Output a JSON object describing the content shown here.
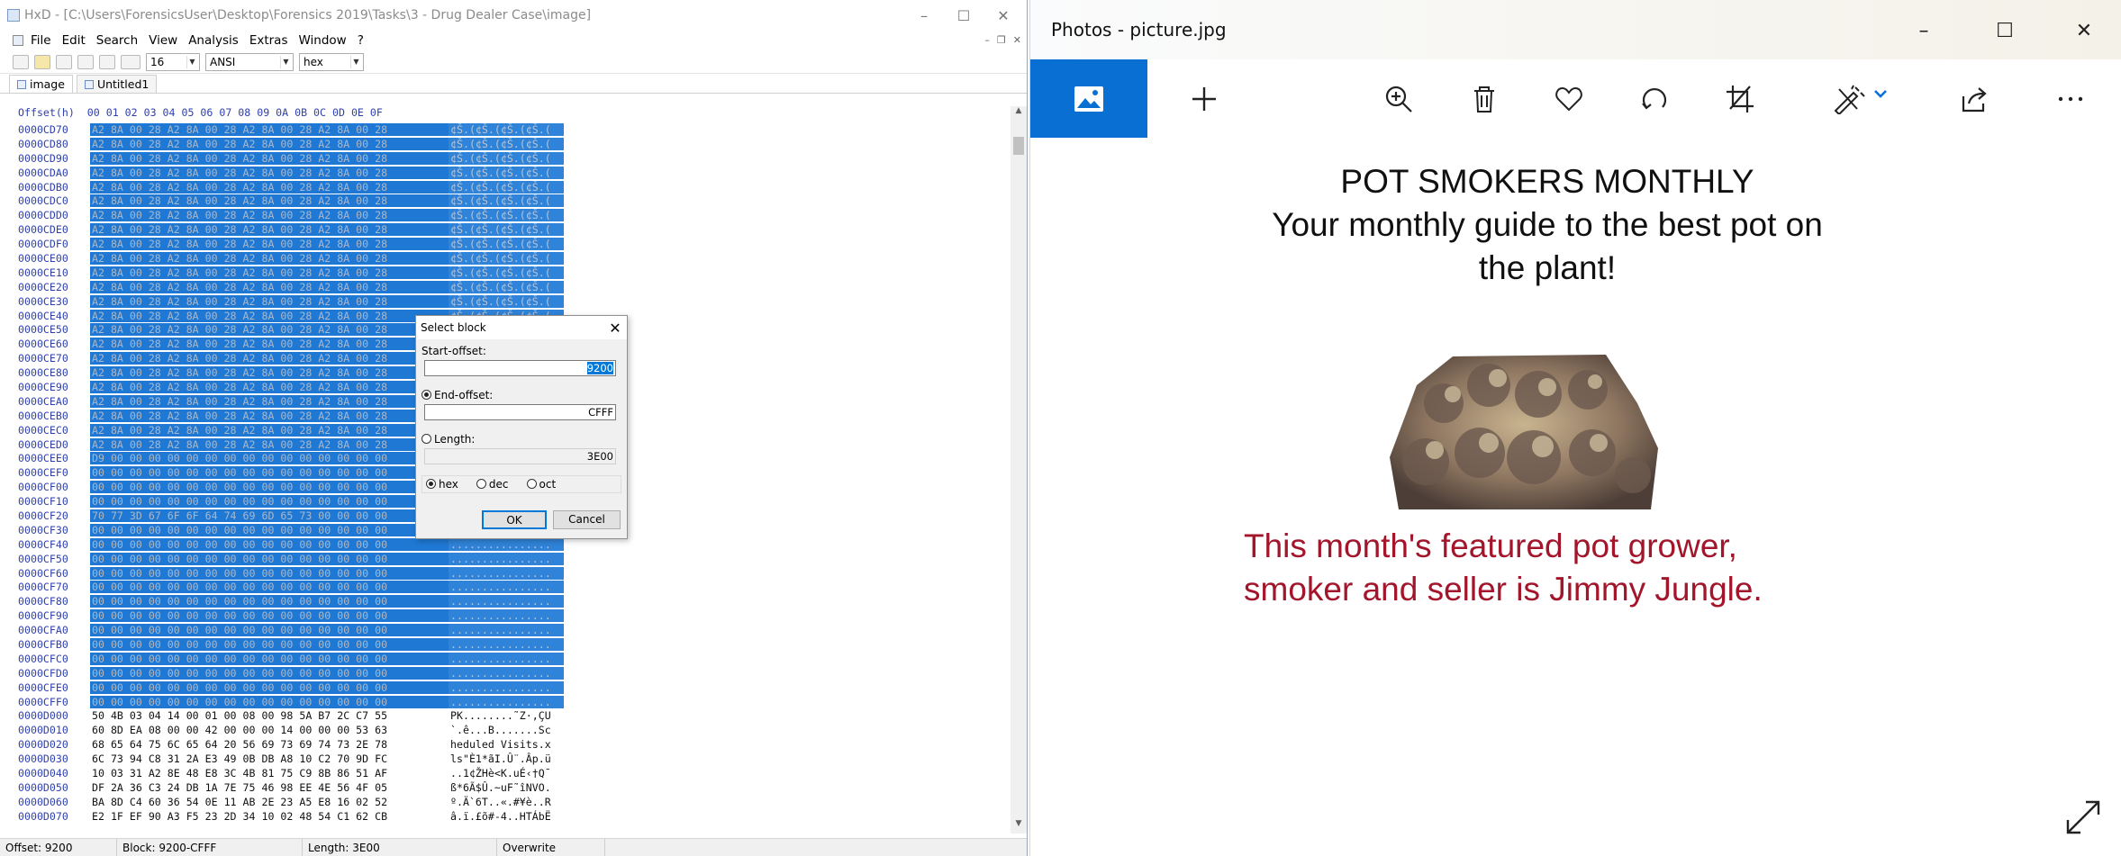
{
  "hxd": {
    "title": "HxD - [C:\\Users\\ForensicsUser\\Desktop\\Forensics 2019\\Tasks\\3 - Drug Dealer Case\\image]",
    "menu": [
      "File",
      "Edit",
      "Search",
      "View",
      "Analysis",
      "Extras",
      "Window",
      "?"
    ],
    "toolbar": {
      "bytes_per_row": "16",
      "charset": "ANSI",
      "display": "hex"
    },
    "tabs": [
      "image",
      "Untitled1"
    ],
    "header": "Offset(h)  00 01 02 03 04 05 06 07 08 09 0A 0B 0C 0D 0E 0F",
    "rows": [
      {
        "off": "0000CD70",
        "hex": "A2 8A 00 28 A2 8A 00 28 A2 8A 00 28 A2 8A 00 28",
        "asc": "¢Š.(¢Š.(¢Š.(¢Š.(",
        "sel": true
      },
      {
        "off": "0000CD80",
        "hex": "A2 8A 00 28 A2 8A 00 28 A2 8A 00 28 A2 8A 00 28",
        "asc": "¢Š.(¢Š.(¢Š.(¢Š.(",
        "sel": true
      },
      {
        "off": "0000CD90",
        "hex": "A2 8A 00 28 A2 8A 00 28 A2 8A 00 28 A2 8A 00 28",
        "asc": "¢Š.(¢Š.(¢Š.(¢Š.(",
        "sel": true
      },
      {
        "off": "0000CDA0",
        "hex": "A2 8A 00 28 A2 8A 00 28 A2 8A 00 28 A2 8A 00 28",
        "asc": "¢Š.(¢Š.(¢Š.(¢Š.(",
        "sel": true
      },
      {
        "off": "0000CDB0",
        "hex": "A2 8A 00 28 A2 8A 00 28 A2 8A 00 28 A2 8A 00 28",
        "asc": "¢Š.(¢Š.(¢Š.(¢Š.(",
        "sel": true
      },
      {
        "off": "0000CDC0",
        "hex": "A2 8A 00 28 A2 8A 00 28 A2 8A 00 28 A2 8A 00 28",
        "asc": "¢Š.(¢Š.(¢Š.(¢Š.(",
        "sel": true
      },
      {
        "off": "0000CDD0",
        "hex": "A2 8A 00 28 A2 8A 00 28 A2 8A 00 28 A2 8A 00 28",
        "asc": "¢Š.(¢Š.(¢Š.(¢Š.(",
        "sel": true
      },
      {
        "off": "0000CDE0",
        "hex": "A2 8A 00 28 A2 8A 00 28 A2 8A 00 28 A2 8A 00 28",
        "asc": "¢Š.(¢Š.(¢Š.(¢Š.(",
        "sel": true
      },
      {
        "off": "0000CDF0",
        "hex": "A2 8A 00 28 A2 8A 00 28 A2 8A 00 28 A2 8A 00 28",
        "asc": "¢Š.(¢Š.(¢Š.(¢Š.(",
        "sel": true
      },
      {
        "off": "0000CE00",
        "hex": "A2 8A 00 28 A2 8A 00 28 A2 8A 00 28 A2 8A 00 28",
        "asc": "¢Š.(¢Š.(¢Š.(¢Š.(",
        "sel": true
      },
      {
        "off": "0000CE10",
        "hex": "A2 8A 00 28 A2 8A 00 28 A2 8A 00 28 A2 8A 00 28",
        "asc": "¢Š.(¢Š.(¢Š.(¢Š.(",
        "sel": true
      },
      {
        "off": "0000CE20",
        "hex": "A2 8A 00 28 A2 8A 00 28 A2 8A 00 28 A2 8A 00 28",
        "asc": "¢Š.(¢Š.(¢Š.(¢Š.(",
        "sel": true
      },
      {
        "off": "0000CE30",
        "hex": "A2 8A 00 28 A2 8A 00 28 A2 8A 00 28 A2 8A 00 28",
        "asc": "¢Š.(¢Š.(¢Š.(¢Š.(",
        "sel": true
      },
      {
        "off": "0000CE40",
        "hex": "A2 8A 00 28 A2 8A 00 28 A2 8A 00 28 A2 8A 00 28",
        "asc": "¢Š.(¢Š.(¢Š.(¢Š.(",
        "sel": true
      },
      {
        "off": "0000CE50",
        "hex": "A2 8A 00 28 A2 8A 00 28 A2 8A 00 28 A2 8A 00 28",
        "asc": "¢Š.(¢Š.(¢Š.(¢Š.(",
        "sel": true
      },
      {
        "off": "0000CE60",
        "hex": "A2 8A 00 28 A2 8A 00 28 A2 8A 00 28 A2 8A 00 28",
        "asc": "¢Š.(¢Š.(¢Š.(¢Š.(",
        "sel": true
      },
      {
        "off": "0000CE70",
        "hex": "A2 8A 00 28 A2 8A 00 28 A2 8A 00 28 A2 8A 00 28",
        "asc": "¢Š.(¢Š.(¢Š.(¢Š.(",
        "sel": true
      },
      {
        "off": "0000CE80",
        "hex": "A2 8A 00 28 A2 8A 00 28 A2 8A 00 28 A2 8A 00 28",
        "asc": "¢Š.(¢Š.(¢Š.(¢Š.(",
        "sel": true
      },
      {
        "off": "0000CE90",
        "hex": "A2 8A 00 28 A2 8A 00 28 A2 8A 00 28 A2 8A 00 28",
        "asc": "¢Š.(¢Š.(¢Š.(¢Š.(",
        "sel": true
      },
      {
        "off": "0000CEA0",
        "hex": "A2 8A 00 28 A2 8A 00 28 A2 8A 00 28 A2 8A 00 28",
        "asc": "¢Š.(¢Š.(¢Š.(¢Š.(",
        "sel": true
      },
      {
        "off": "0000CEB0",
        "hex": "A2 8A 00 28 A2 8A 00 28 A2 8A 00 28 A2 8A 00 28",
        "asc": "¢Š.(¢Š.(¢Š.(¢Š.(",
        "sel": true
      },
      {
        "off": "0000CEC0",
        "hex": "A2 8A 00 28 A2 8A 00 28 A2 8A 00 28 A2 8A 00 28",
        "asc": "¢Š.(¢Š.(¢Š.(¢Š.(",
        "sel": true
      },
      {
        "off": "0000CED0",
        "hex": "A2 8A 00 28 A2 8A 00 28 A2 8A 00 28 A2 8A 00 28",
        "asc": "¢Š.(¢Š.(¢Š.(¢Š.(",
        "sel": true
      },
      {
        "off": "0000CEE0",
        "hex": "D9 00 00 00 00 00 00 00 00 00 00 00 00 00 00 00",
        "asc": "Ù...............",
        "sel": true
      },
      {
        "off": "0000CEF0",
        "hex": "00 00 00 00 00 00 00 00 00 00 00 00 00 00 00 00",
        "asc": "................",
        "sel": true
      },
      {
        "off": "0000CF00",
        "hex": "00 00 00 00 00 00 00 00 00 00 00 00 00 00 00 00",
        "asc": "................",
        "sel": true
      },
      {
        "off": "0000CF10",
        "hex": "00 00 00 00 00 00 00 00 00 00 00 00 00 00 00 00",
        "asc": "................",
        "sel": true
      },
      {
        "off": "0000CF20",
        "hex": "70 77 3D 67 6F 6F 64 74 69 6D 65 73 00 00 00 00",
        "asc": "pw=goodtimes....",
        "sel": true
      },
      {
        "off": "0000CF30",
        "hex": "00 00 00 00 00 00 00 00 00 00 00 00 00 00 00 00",
        "asc": "................",
        "sel": true
      },
      {
        "off": "0000CF40",
        "hex": "00 00 00 00 00 00 00 00 00 00 00 00 00 00 00 00",
        "asc": "................",
        "sel": true
      },
      {
        "off": "0000CF50",
        "hex": "00 00 00 00 00 00 00 00 00 00 00 00 00 00 00 00",
        "asc": "................",
        "sel": true
      },
      {
        "off": "0000CF60",
        "hex": "00 00 00 00 00 00 00 00 00 00 00 00 00 00 00 00",
        "asc": "................",
        "sel": true
      },
      {
        "off": "0000CF70",
        "hex": "00 00 00 00 00 00 00 00 00 00 00 00 00 00 00 00",
        "asc": "................",
        "sel": true
      },
      {
        "off": "0000CF80",
        "hex": "00 00 00 00 00 00 00 00 00 00 00 00 00 00 00 00",
        "asc": "................",
        "sel": true
      },
      {
        "off": "0000CF90",
        "hex": "00 00 00 00 00 00 00 00 00 00 00 00 00 00 00 00",
        "asc": "................",
        "sel": true
      },
      {
        "off": "0000CFA0",
        "hex": "00 00 00 00 00 00 00 00 00 00 00 00 00 00 00 00",
        "asc": "................",
        "sel": true
      },
      {
        "off": "0000CFB0",
        "hex": "00 00 00 00 00 00 00 00 00 00 00 00 00 00 00 00",
        "asc": "................",
        "sel": true
      },
      {
        "off": "0000CFC0",
        "hex": "00 00 00 00 00 00 00 00 00 00 00 00 00 00 00 00",
        "asc": "................",
        "sel": true
      },
      {
        "off": "0000CFD0",
        "hex": "00 00 00 00 00 00 00 00 00 00 00 00 00 00 00 00",
        "asc": "................",
        "sel": true
      },
      {
        "off": "0000CFE0",
        "hex": "00 00 00 00 00 00 00 00 00 00 00 00 00 00 00 00",
        "asc": "................",
        "sel": true
      },
      {
        "off": "0000CFF0",
        "hex": "00 00 00 00 00 00 00 00 00 00 00 00 00 00 00 00",
        "asc": "................",
        "sel": true
      },
      {
        "off": "0000D000",
        "hex": "50 4B 03 04 14 00 01 00 08 00 98 5A B7 2C C7 55",
        "asc": "PK........˜Z·,ÇU",
        "sel": false
      },
      {
        "off": "0000D010",
        "hex": "60 8D EA 08 00 00 42 00 00 00 14 00 00 00 53 63",
        "asc": "`.ê...B.......Sc",
        "sel": false
      },
      {
        "off": "0000D020",
        "hex": "68 65 64 75 6C 65 64 20 56 69 73 69 74 73 2E 78",
        "asc": "heduled Visits.x",
        "sel": false
      },
      {
        "off": "0000D030",
        "hex": "6C 73 94 C8 31 2A E3 49 0B DB A8 10 C2 70 9D FC",
        "asc": "ls\"È1*ãI.Û¨.Âp.ü",
        "sel": false
      },
      {
        "off": "0000D040",
        "hex": "10 03 31 A2 8E 48 E8 3C 4B 81 75 C9 8B 86 51 AF",
        "asc": "..1¢ŽHè<K.uÉ‹†Q¯",
        "sel": false
      },
      {
        "off": "0000D050",
        "hex": "DF 2A 36 C3 24 DB 1A 7E 75 46 98 EE 4E 56 4F 05",
        "asc": "ß*6Ã$Û.~uF˜îNVO.",
        "sel": false
      },
      {
        "off": "0000D060",
        "hex": "BA 8D C4 60 36 54 0E 11 AB 2E 23 A5 E8 16 02 52",
        "asc": "º.Ä`6T..«.#¥è..R",
        "sel": false
      },
      {
        "off": "0000D070",
        "hex": "E2 1F EF 90 A3 F5 23 2D 34 10 02 48 54 C1 62 CB",
        "asc": "â.ï.£õ#-4..HTÁbË",
        "sel": false
      }
    ],
    "status": {
      "offset": "Offset: 9200",
      "block": "Block: 9200-CFFF",
      "length": "Length: 3E00",
      "mode": "Overwrite"
    }
  },
  "dialog": {
    "title": "Select block",
    "start_label": "Start-offset:",
    "start_value": "9200",
    "end_label": "End-offset:",
    "end_value": "CFFF",
    "length_label": "Length:",
    "length_value": "3E00",
    "radix": [
      "hex",
      "dec",
      "oct"
    ],
    "ok": "OK",
    "cancel": "Cancel"
  },
  "photos": {
    "title": "Photos - picture.jpg",
    "image_text": {
      "line1": "POT SMOKERS MONTHLY",
      "line2": "Your monthly guide to the best pot on",
      "line3": "the plant!",
      "line4": "This month's featured pot grower,",
      "line5": "smoker and seller is Jimmy Jungle."
    }
  }
}
